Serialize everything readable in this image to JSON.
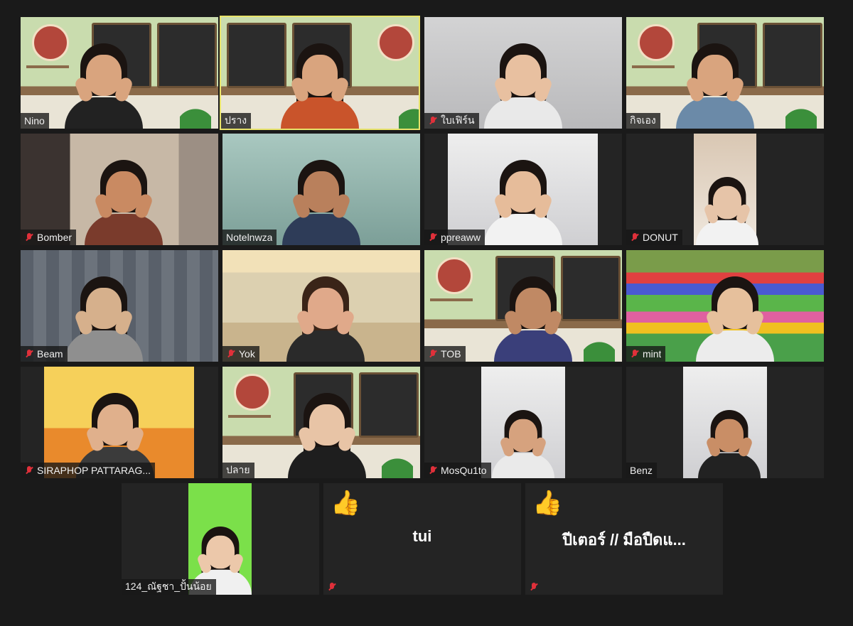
{
  "participants": [
    {
      "name": "Nino",
      "muted": false
    },
    {
      "name": "ปราง",
      "muted": false
    },
    {
      "name": "ใบเฟิร์น",
      "muted": true
    },
    {
      "name": "กิจเอง",
      "muted": false
    },
    {
      "name": "Bomber",
      "muted": true
    },
    {
      "name": "Notelnwza",
      "muted": false
    },
    {
      "name": "ppreaww",
      "muted": true
    },
    {
      "name": "DONUT",
      "muted": true
    },
    {
      "name": "Beam",
      "muted": true
    },
    {
      "name": "Yok",
      "muted": true
    },
    {
      "name": "TOB",
      "muted": true
    },
    {
      "name": "mint",
      "muted": true
    },
    {
      "name": "SIRAPHOP PATTARAG...",
      "muted": true
    },
    {
      "name": "ปลาย",
      "muted": false
    },
    {
      "name": "MosQu1to",
      "muted": true
    },
    {
      "name": "Benz",
      "muted": false
    },
    {
      "name": "124_ณัฐชา_ปั้นน้อย",
      "muted": false
    },
    {
      "name": "tui",
      "muted": true,
      "reaction": "👍"
    },
    {
      "name": "ปีเตอร์ // มือปืดแ...",
      "muted": true,
      "reaction": "👍"
    }
  ],
  "active_speaker": "ปราง",
  "colors": {
    "active_border": "#e8e36b",
    "muted_icon": "#e0303a",
    "background": "#1a1a1a"
  },
  "icons": {
    "muted": "mic-muted-icon",
    "reaction": "thumbs-up-icon"
  }
}
